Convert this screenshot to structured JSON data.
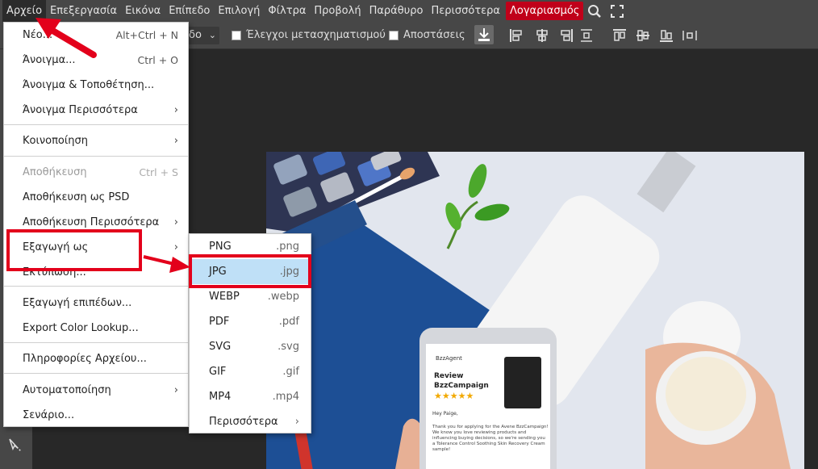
{
  "menubar": {
    "items": [
      "Αρχείο",
      "Επεξεργασία",
      "Εικόνα",
      "Επίπεδο",
      "Επιλογή",
      "Φίλτρα",
      "Προβολή",
      "Παράθυρο",
      "Περισσότερα"
    ],
    "account": "Λογαριασμός",
    "icons": [
      "search-icon",
      "fullscreen-icon"
    ]
  },
  "optbar": {
    "select_value": "δο",
    "transform_controls": "Έλεγχοι μετασχηματισμού",
    "distances": "Αποστάσεις"
  },
  "file_menu": {
    "items": [
      {
        "label": "Νέο...",
        "shortcut": "Alt+Ctrl + N"
      },
      {
        "label": "Άνοιγμα...",
        "shortcut": "Ctrl + O"
      },
      {
        "label": "Άνοιγμα & Τοποθέτηση..."
      },
      {
        "label": "Άνοιγμα Περισσότερα",
        "arrow": "›"
      },
      {
        "label": "Κοινοποίηση",
        "arrow": "›"
      },
      {
        "label": "Αποθήκευση",
        "shortcut": "Ctrl + S"
      },
      {
        "label": "Αποθήκευση ως PSD"
      },
      {
        "label": "Αποθήκευση Περισσότερα",
        "arrow": "›"
      },
      {
        "label": "Εξαγωγή ως",
        "arrow": "›"
      },
      {
        "label": "Εκτύπωση..."
      },
      {
        "label": "Εξαγωγή επιπέδων..."
      },
      {
        "label": "Export Color Lookup..."
      },
      {
        "label": "Πληροφορίες Αρχείου..."
      },
      {
        "label": "Αυτοματοποίηση",
        "arrow": "›"
      },
      {
        "label": "Σενάριο..."
      }
    ]
  },
  "export_submenu": {
    "items": [
      {
        "label": "PNG",
        "ext": ".png"
      },
      {
        "label": "JPG",
        "ext": ".jpg"
      },
      {
        "label": "WEBP",
        "ext": ".webp"
      },
      {
        "label": "PDF",
        "ext": ".pdf"
      },
      {
        "label": "SVG",
        "ext": ".svg"
      },
      {
        "label": "GIF",
        "ext": ".gif"
      },
      {
        "label": "MP4",
        "ext": ".mp4"
      },
      {
        "label": "Περισσότερα",
        "ext": "›"
      }
    ]
  },
  "photo": {
    "phone_brand": "BzzAgent",
    "phone_title_1": "Review",
    "phone_title_2": "BzzCampaign",
    "phone_stars": "★★★★★",
    "phone_greeting": "Hey Paige,",
    "phone_body": "Thank you for applying for the Avene BzzCampaign! We know you love reviewing products and influencing buying decisions, so we're sending you a Tolerance Control Soothing Skin Recovery Cream sample!"
  },
  "colors": {
    "accent_red": "#e3001b",
    "account_bg": "#c0001a",
    "highlight": "#bfe0f7"
  }
}
